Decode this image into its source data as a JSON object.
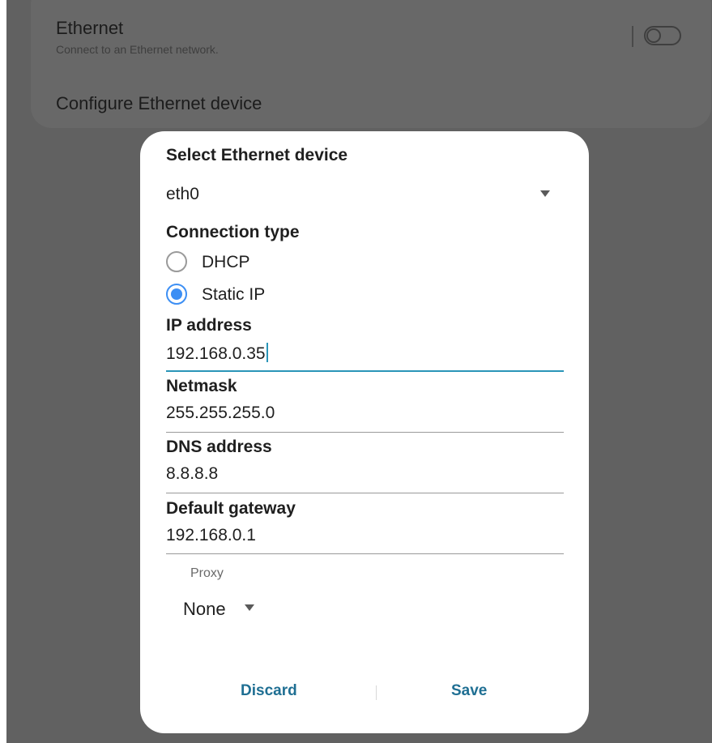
{
  "background": {
    "ethernet": {
      "title": "Ethernet",
      "subtitle": "Connect to an Ethernet network.",
      "toggle_on": false
    },
    "configure_label": "Configure Ethernet device"
  },
  "dialog": {
    "title": "Select Ethernet device",
    "device": {
      "selected": "eth0"
    },
    "connection_type": {
      "label": "Connection type",
      "options": [
        {
          "label": "DHCP",
          "checked": false
        },
        {
          "label": "Static IP",
          "checked": true
        }
      ]
    },
    "fields": {
      "ip": {
        "label": "IP address",
        "value": "192.168.0.35"
      },
      "netmask": {
        "label": "Netmask",
        "value": "255.255.255.0"
      },
      "dns": {
        "label": "DNS address",
        "value": "8.8.8.8"
      },
      "gateway": {
        "label": "Default gateway",
        "value": "192.168.0.1"
      }
    },
    "proxy": {
      "label": "Proxy",
      "value": "None"
    },
    "buttons": {
      "discard": "Discard",
      "save": "Save"
    }
  },
  "colors": {
    "scrim": "#616161",
    "accent": "#3d8ff4",
    "button_text": "#1f6f93",
    "focus_underline": "#2a95b8"
  }
}
